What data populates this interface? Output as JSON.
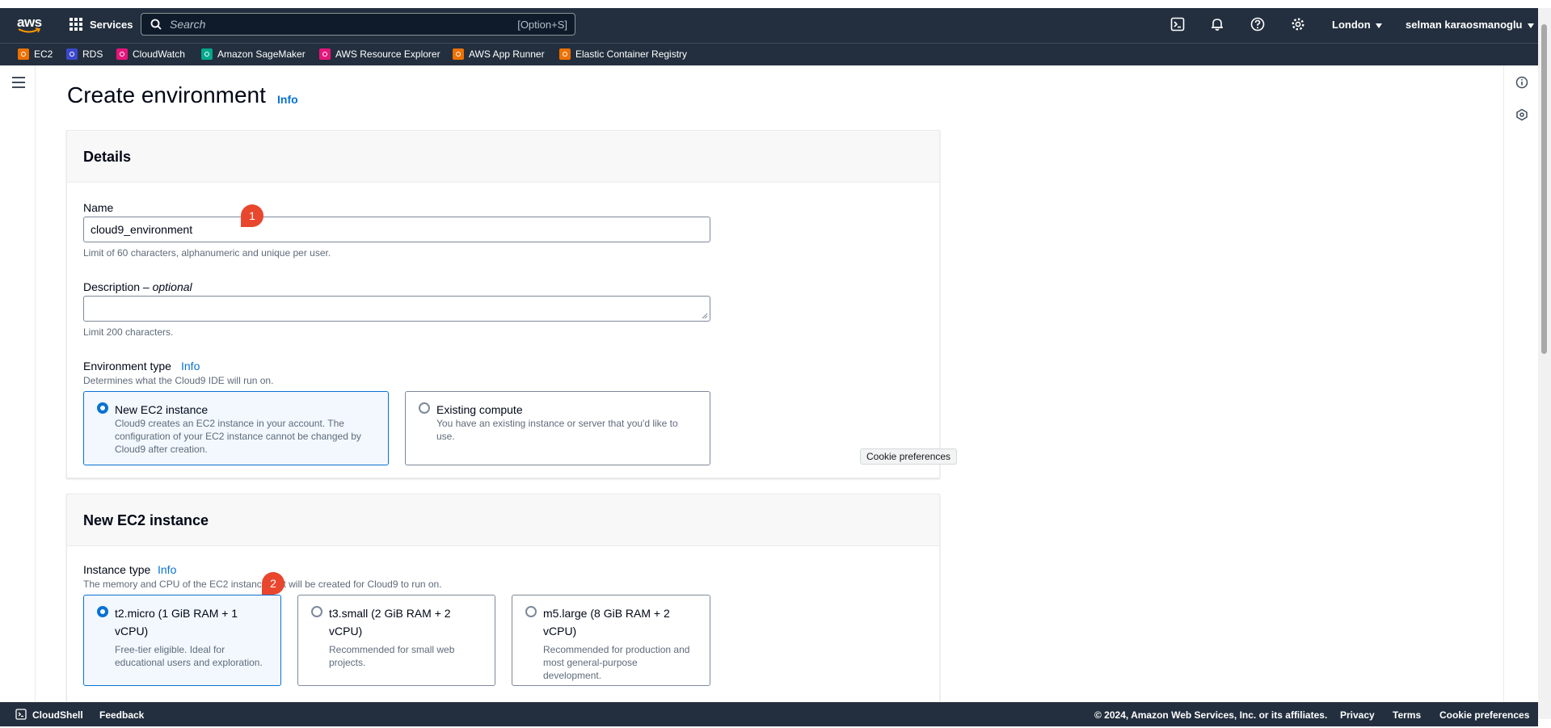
{
  "header": {
    "logo_text": "aws",
    "services_label": "Services",
    "search_placeholder": "Search",
    "search_shortcut": "[Option+S]",
    "region": "London",
    "user": "selman karaosmanoglu"
  },
  "favorites": [
    {
      "label": "EC2",
      "color": "#ed7100"
    },
    {
      "label": "RDS",
      "color": "#3b48cc"
    },
    {
      "label": "CloudWatch",
      "color": "#e7157b"
    },
    {
      "label": "Amazon SageMaker",
      "color": "#01a88d"
    },
    {
      "label": "AWS Resource Explorer",
      "color": "#e7157b"
    },
    {
      "label": "AWS App Runner",
      "color": "#ed7100"
    },
    {
      "label": "Elastic Container Registry",
      "color": "#ed7100"
    }
  ],
  "page": {
    "title": "Create environment",
    "info": "Info"
  },
  "details": {
    "heading": "Details",
    "name_label": "Name",
    "name_value": "cloud9_environment",
    "name_hint": "Limit of 60 characters, alphanumeric and unique per user.",
    "description_label": "Description –",
    "description_optional": "optional",
    "description_hint": "Limit 200 characters.",
    "env_type_label": "Environment type",
    "env_type_info": "Info",
    "env_type_hint": "Determines what the Cloud9 IDE will run on.",
    "options": [
      {
        "title": "New EC2 instance",
        "desc_lines": [
          "Cloud9 creates an EC2 instance in your account. The",
          "configuration of your EC2 instance cannot be changed by",
          "Cloud9 after creation."
        ],
        "selected": true
      },
      {
        "title": "Existing compute",
        "desc_lines": [
          "You have an existing instance or server that you'd like to",
          "use."
        ],
        "selected": false
      }
    ]
  },
  "ec2": {
    "heading": "New EC2 instance",
    "instance_type_label": "Instance type",
    "instance_type_info": "Info",
    "instance_type_hint": "The memory and CPU of the EC2 instance that will be created for Cloud9 to run on.",
    "options": [
      {
        "title_lines": [
          "t2.micro (1 GiB RAM + 1",
          "vCPU)"
        ],
        "desc_lines": [
          "Free-tier eligible. Ideal for",
          "educational users and exploration."
        ],
        "selected": true
      },
      {
        "title_lines": [
          "t3.small (2 GiB RAM + 2",
          "vCPU)"
        ],
        "desc_lines": [
          "Recommended for small web",
          "projects."
        ],
        "selected": false
      },
      {
        "title_lines": [
          "m5.large (8 GiB RAM + 2",
          "vCPU)"
        ],
        "desc_lines": [
          "Recommended for production and",
          "most general-purpose",
          "development."
        ],
        "selected": false
      }
    ]
  },
  "badges": [
    "1",
    "2"
  ],
  "cookie_tooltip": "Cookie preferences",
  "footer": {
    "cloudshell": "CloudShell",
    "feedback": "Feedback",
    "copyright": "© 2024, Amazon Web Services, Inc. or its affiliates.",
    "privacy": "Privacy",
    "terms": "Terms",
    "cookie": "Cookie preferences"
  }
}
